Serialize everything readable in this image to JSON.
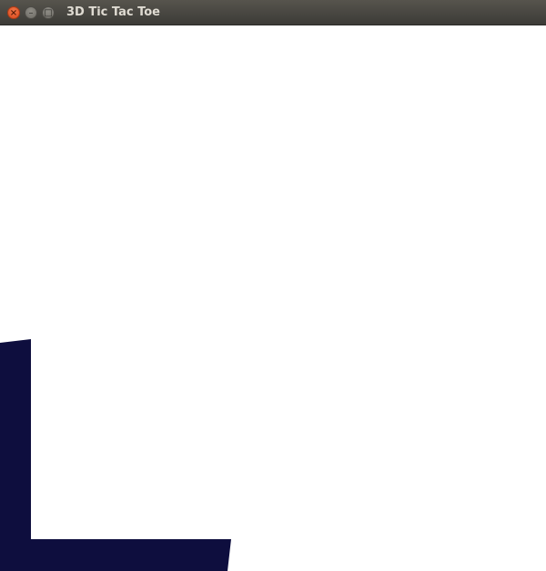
{
  "window": {
    "title": "3D Tic Tac Toe",
    "close_glyph": "×",
    "minimize_glyph": "–",
    "maximize_glyph": "□"
  },
  "scene": {
    "background_color": "#ffffff",
    "board_color": "#0e0e3e",
    "board_frame_visible": "partial (bottom-left corner of board frame only)"
  },
  "icons": [
    "close-icon",
    "minimize-icon",
    "maximize-icon"
  ]
}
